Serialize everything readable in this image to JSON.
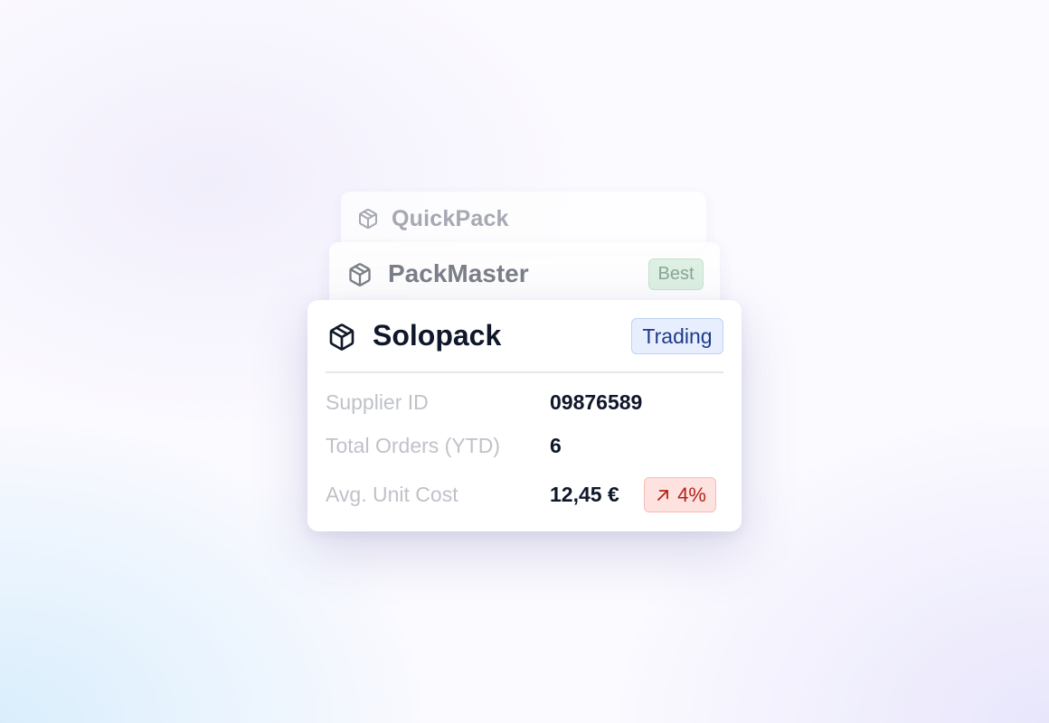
{
  "suppliers": [
    {
      "name": "QuickPack",
      "icon": "package-icon"
    },
    {
      "name": "PackMaster",
      "icon": "package-icon",
      "badge": "Best"
    },
    {
      "name": "Solopack",
      "icon": "package-icon",
      "badge": "Trading"
    }
  ],
  "details": {
    "supplier_id_label": "Supplier ID",
    "supplier_id_value": "09876589",
    "total_orders_label": "Total Orders (YTD)",
    "total_orders_value": "6",
    "avg_unit_cost_label": "Avg. Unit Cost",
    "avg_unit_cost_value": "12,45 €",
    "trend_icon": "arrow-up-right-icon",
    "trend_value": "4%"
  },
  "colors": {
    "best_badge": "#d9efe0",
    "trading_badge": "#e7efff",
    "trend_badge": "#fde2df",
    "trend_text": "#b42318"
  }
}
